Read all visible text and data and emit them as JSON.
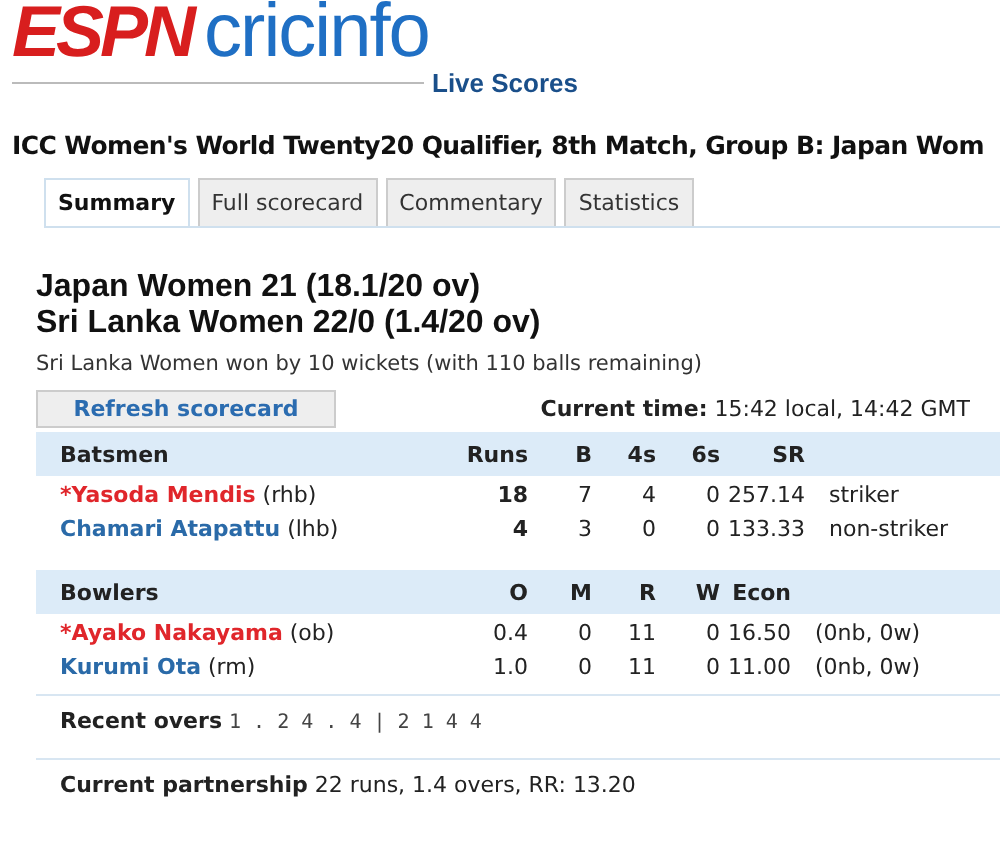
{
  "logo": {
    "brand": "ESPN",
    "name": "cricinfo",
    "subtitle": "Live Scores"
  },
  "match_title": "ICC Women's World Twenty20 Qualifier, 8th Match, Group B: Japan Wom",
  "tabs": [
    {
      "label": "Summary",
      "selected": true
    },
    {
      "label": "Full scorecard",
      "selected": false
    },
    {
      "label": "Commentary",
      "selected": false
    },
    {
      "label": "Statistics",
      "selected": false
    }
  ],
  "scores": [
    "Japan Women 21 (18.1/20 ov)",
    "Sri Lanka Women 22/0 (1.4/20 ov)"
  ],
  "result": "Sri Lanka Women won by 10 wickets (with 110 balls remaining)",
  "refresh_button": "Refresh scorecard",
  "current_time": {
    "label": "Current time:",
    "value": "15:42 local, 14:42 GMT"
  },
  "batsmen": {
    "columns": [
      "Batsmen",
      "Runs",
      "B",
      "4s",
      "6s",
      "SR"
    ],
    "rows": [
      {
        "name": "*Yasoda Mendis",
        "style": "(rhb)",
        "on_strike": true,
        "stats": [
          "18",
          "7",
          "4",
          "0",
          "257.14"
        ],
        "note": "striker"
      },
      {
        "name": "Chamari Atapattu",
        "style": "(lhb)",
        "on_strike": false,
        "stats": [
          "4",
          "3",
          "0",
          "0",
          "133.33"
        ],
        "note": "non-striker"
      }
    ]
  },
  "bowlers": {
    "columns": [
      "Bowlers",
      "O",
      "M",
      "R",
      "W",
      "Econ"
    ],
    "rows": [
      {
        "name": "*Ayako Nakayama",
        "style": "(ob)",
        "on_strike": true,
        "stats": [
          "0.4",
          "0",
          "11",
          "0",
          "16.50"
        ],
        "note": "(0nb, 0w)"
      },
      {
        "name": "Kurumi Ota",
        "style": "(rm)",
        "on_strike": false,
        "stats": [
          "1.0",
          "0",
          "11",
          "0",
          "11.00"
        ],
        "note": "(0nb, 0w)"
      }
    ]
  },
  "recent_overs": {
    "label": "Recent overs",
    "value": "1 . 2 4 . 4 | 2 1 4 4"
  },
  "partnership": {
    "label": "Current partnership",
    "value": "22 runs, 1.4 overs, RR: 13.20"
  }
}
